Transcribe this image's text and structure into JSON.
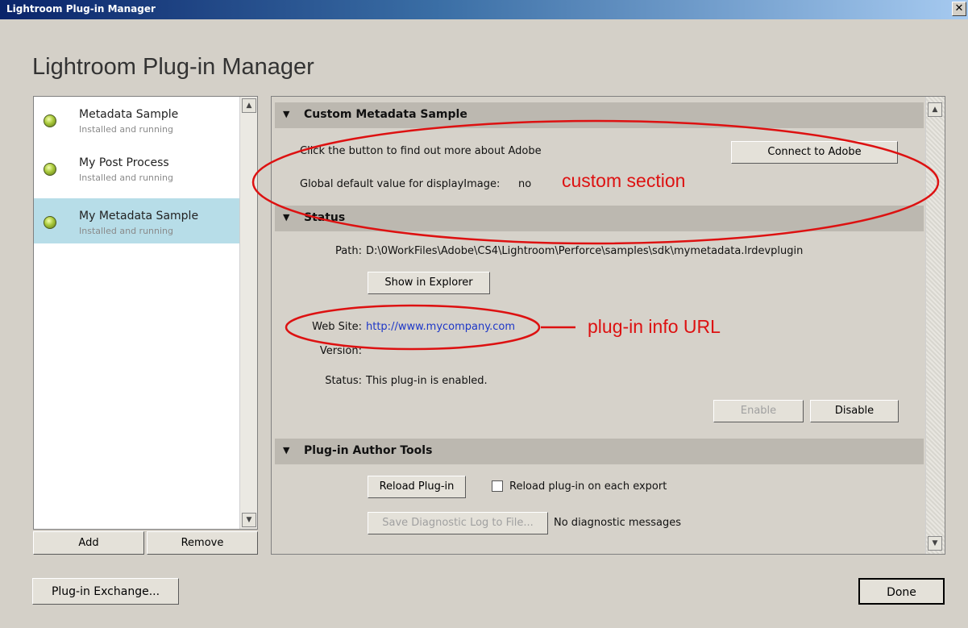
{
  "window": {
    "title": "Lightroom Plug-in Manager",
    "close_glyph": "✕"
  },
  "dialog": {
    "heading": "Lightroom Plug-in Manager"
  },
  "plugins": [
    {
      "name": "Metadata Sample",
      "status": "Installed and running"
    },
    {
      "name": "My Post Process",
      "status": "Installed and running"
    },
    {
      "name": "My Metadata Sample",
      "status": "Installed and running",
      "selected": true
    }
  ],
  "list_buttons": {
    "add": "Add",
    "remove": "Remove"
  },
  "sections": {
    "custom": {
      "title": "Custom Metadata Sample",
      "info_text": "Click the button to find out more about Adobe",
      "connect_button": "Connect to Adobe",
      "global_label": "Global default value for displayImage:",
      "global_value": "no"
    },
    "status": {
      "title": "Status",
      "path_label": "Path:",
      "path_value": "D:\\0WorkFiles\\Adobe\\CS4\\Lightroom\\Perforce\\samples\\sdk\\mymetadata.lrdevplugin",
      "show_button": "Show in Explorer",
      "website_label": "Web Site:",
      "website_value": "http://www.mycompany.com",
      "version_label": "Version:",
      "status_label": "Status:",
      "status_value": "This plug-in is enabled.",
      "enable_button": "Enable",
      "disable_button": "Disable"
    },
    "author_tools": {
      "title": "Plug-in Author Tools",
      "reload_button": "Reload Plug-in",
      "reload_checkbox_label": "Reload plug-in on each export",
      "reload_checked": false,
      "save_log_button": "Save Diagnostic Log to File...",
      "diagnostic_text": "No diagnostic messages"
    }
  },
  "annotations": {
    "custom_section": "custom section",
    "plugin_info_url": "plug-in info URL"
  },
  "footer": {
    "exchange_button": "Plug-in Exchange...",
    "done_button": "Done"
  },
  "colors": {
    "selected_item": "#b7dde8",
    "link": "#1d37c8",
    "annotation": "#dd1111",
    "section_header": "#bcb8b0"
  }
}
